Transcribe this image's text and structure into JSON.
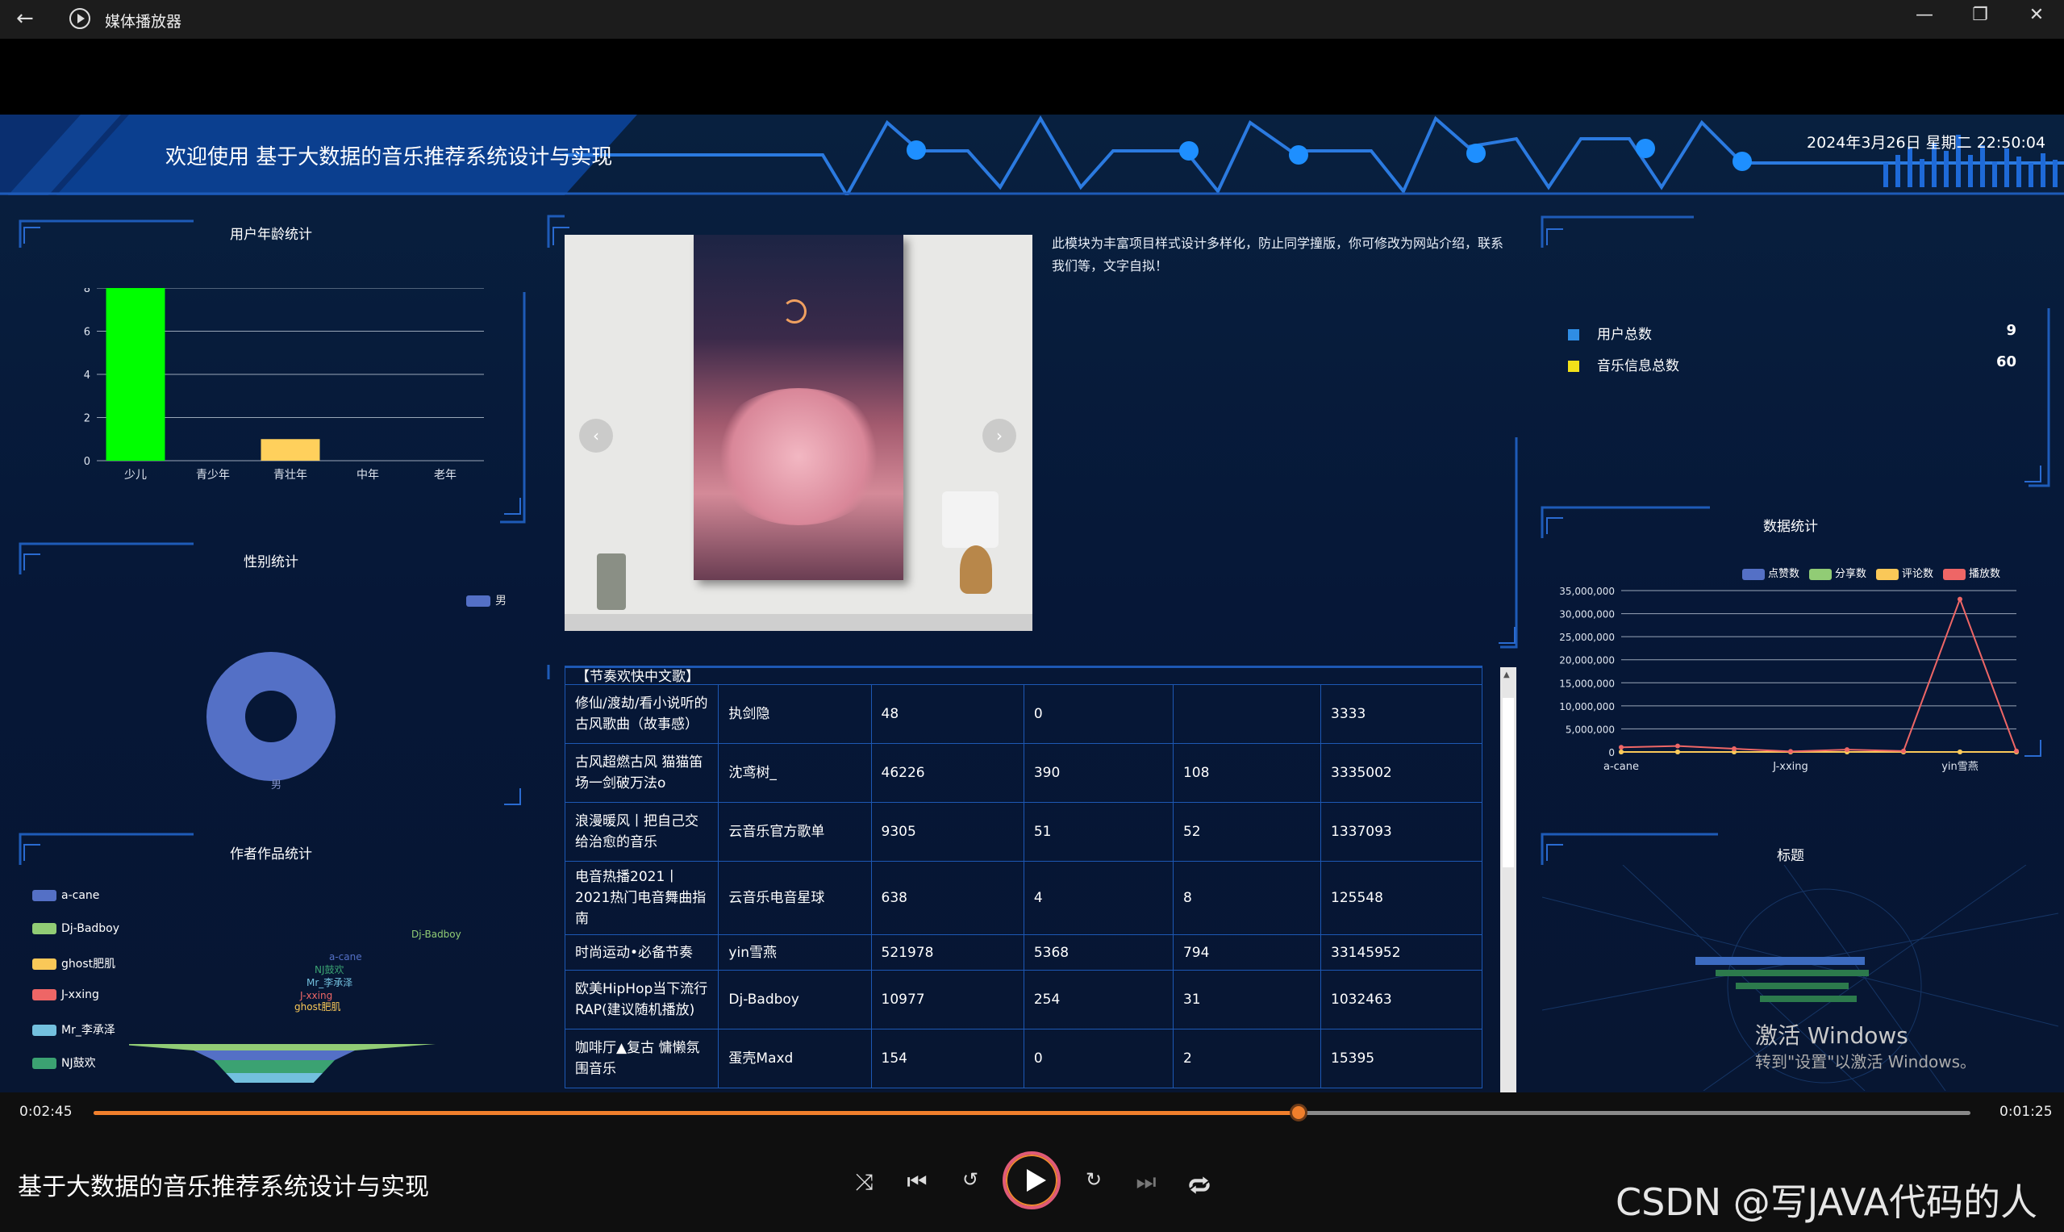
{
  "window": {
    "title": "媒体播放器",
    "back": "←",
    "minimize": "—",
    "restore": "❐",
    "close": "✕"
  },
  "header": {
    "title": "欢迎使用 基于大数据的音乐推荐系统设计与实现",
    "datetime": "2024年3月26日 星期二 22:50:04"
  },
  "age_panel": {
    "title": "用户年龄统计"
  },
  "gender_panel": {
    "title": "性别统计",
    "legend": "男",
    "slice_label": "男"
  },
  "works_panel": {
    "title": "作者作品统计",
    "legend": [
      "a-cane",
      "Dj-Badboy",
      "ghost肥肌",
      "J-xxing",
      "Mr_李承泽",
      "NJ鼓欢"
    ],
    "funnel_labels": [
      "Dj-Badboy",
      "a-cane",
      "NJ鼓欢",
      "Mr_李承泽",
      "J-xxing",
      "ghost肥肌"
    ]
  },
  "intro": {
    "text": "此模块为丰富项目样式设计多样化，防止同学撞版，你可修改为网站介绍，联系我们等，文字自拟！"
  },
  "stats": {
    "user_total_label": "用户总数",
    "user_total_value": "9",
    "music_total_label": "音乐信息总数",
    "music_total_value": "60"
  },
  "data_panel": {
    "title": "数据统计"
  },
  "bottom_right_panel": {
    "title": "标题"
  },
  "table": {
    "partial_row": "【节奏欢快中文歌】",
    "rows": [
      [
        "修仙/渡劫/看小说听的古风歌曲（故事感）",
        "执剑隐",
        "48",
        "0",
        "",
        "3333"
      ],
      [
        "古风超燃古风 猫猫笛场一剑破万法o",
        "沈鸢树_",
        "46226",
        "390",
        "108",
        "3335002"
      ],
      [
        "浪漫暖风丨把自己交给治愈的音乐",
        "云音乐官方歌单",
        "9305",
        "51",
        "52",
        "1337093"
      ],
      [
        "电音热播2021丨2021热门电音舞曲指南",
        "云音乐电音星球",
        "638",
        "4",
        "8",
        "125548"
      ],
      [
        "时尚运动•必备节奏",
        "yin雪燕",
        "521978",
        "5368",
        "794",
        "33145952"
      ],
      [
        "欧美HipHop当下流行RAP(建议随机播放)",
        "Dj-Badboy",
        "10977",
        "254",
        "31",
        "1032463"
      ],
      [
        "咖啡厅▲复古 慵懒氛围音乐",
        "蛋壳Maxd",
        "154",
        "0",
        "2",
        "15395"
      ]
    ]
  },
  "windows_activation": {
    "line1": "激活 Windows",
    "line2": "转到\"设置\"以激活 Windows。"
  },
  "player": {
    "elapsed": "0:02:45",
    "remaining": "0:01:25",
    "progress": 0.642,
    "now_playing": "基于大数据的音乐推荐系统设计与实现",
    "watermark": "CSDN @写JAVA代码的人"
  },
  "chart_data": [
    {
      "type": "bar",
      "title": "用户年龄统计",
      "categories": [
        "少儿",
        "青少年",
        "青壮年",
        "中年",
        "老年"
      ],
      "values": [
        8,
        0,
        1,
        0,
        0
      ],
      "colors": [
        "#00ff00",
        "#ffd05c",
        "#ffd05c",
        "#ffd05c",
        "#ffd05c"
      ],
      "ylim": [
        0,
        8
      ],
      "yticks": [
        "0",
        "2",
        "4",
        "6",
        "8"
      ],
      "grid": true
    },
    {
      "type": "pie",
      "title": "性别统计",
      "series": [
        {
          "name": "男",
          "values": [
            1
          ]
        }
      ],
      "colors": [
        "#5470c6"
      ],
      "legend": "top-right"
    },
    {
      "type": "funnel",
      "title": "作者作品统计",
      "categories": [
        "Dj-Badboy",
        "a-cane",
        "NJ鼓欢",
        "Mr_李承泽",
        "J-xxing",
        "ghost肥肌"
      ],
      "colors": [
        "#91cc75",
        "#5470c6",
        "#3ba272",
        "#73c0de",
        "#ee6666",
        "#fac858"
      ],
      "legend": "left"
    },
    {
      "type": "line",
      "title": "数据统计",
      "categories": [
        "a-cane",
        "",
        "",
        "J-xxing",
        "",
        "",
        "yin雪燕",
        ""
      ],
      "xticks": [
        "a-cane",
        "J-xxing",
        "yin雪燕"
      ],
      "series": [
        {
          "name": "点赞数",
          "color": "#5470c6",
          "values": [
            0,
            0,
            0,
            0,
            0,
            0,
            0,
            0
          ]
        },
        {
          "name": "分享数",
          "color": "#91cc75",
          "values": [
            0,
            0,
            0,
            0,
            0,
            0,
            0,
            0
          ]
        },
        {
          "name": "评论数",
          "color": "#fac858",
          "values": [
            0,
            0,
            0,
            0,
            0,
            0,
            0,
            0
          ]
        },
        {
          "name": "播放数",
          "color": "#ee6666",
          "values": [
            1000000,
            1300000,
            700000,
            100000,
            500000,
            200000,
            33145952,
            200000
          ]
        }
      ],
      "ylim": [
        0,
        35000000
      ],
      "yticks": [
        "0",
        "5,000,000",
        "10,000,000",
        "15,000,000",
        "20,000,000",
        "25,000,000",
        "30,000,000",
        "35,000,000"
      ],
      "legend": "top-right",
      "grid": true
    }
  ]
}
